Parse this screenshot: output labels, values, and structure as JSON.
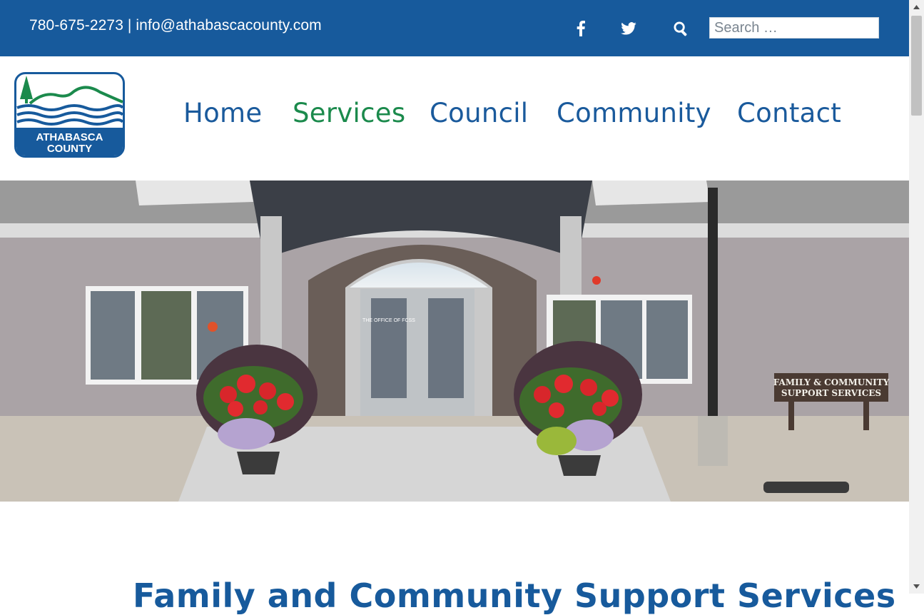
{
  "topbar": {
    "phone": "780-675-2273",
    "separator": "|",
    "email": "info@athabascacounty.com",
    "social": [
      {
        "name": "facebook-icon"
      },
      {
        "name": "twitter-icon"
      }
    ],
    "search_icon": "search-icon",
    "search_placeholder": "Search …"
  },
  "logo": {
    "line1": "ATHABASCA",
    "line2": "COUNTY"
  },
  "nav": {
    "items": [
      {
        "label": "Home",
        "active": false
      },
      {
        "label": "Services",
        "active": true
      },
      {
        "label": "Council",
        "active": false
      },
      {
        "label": "Community",
        "active": false
      },
      {
        "label": "Contact",
        "active": false
      }
    ]
  },
  "hero": {
    "sign_line1": "FAMILY & COMMUNITY",
    "sign_line2": "SUPPORT SERVICES",
    "door_text": "THE OFFICE OF FCSS"
  },
  "page": {
    "heading": "Family and Community Support Services"
  },
  "colors": {
    "brand_blue": "#175a9c",
    "nav_blue": "#1a5a9c",
    "active_green": "#1b8a4c"
  }
}
